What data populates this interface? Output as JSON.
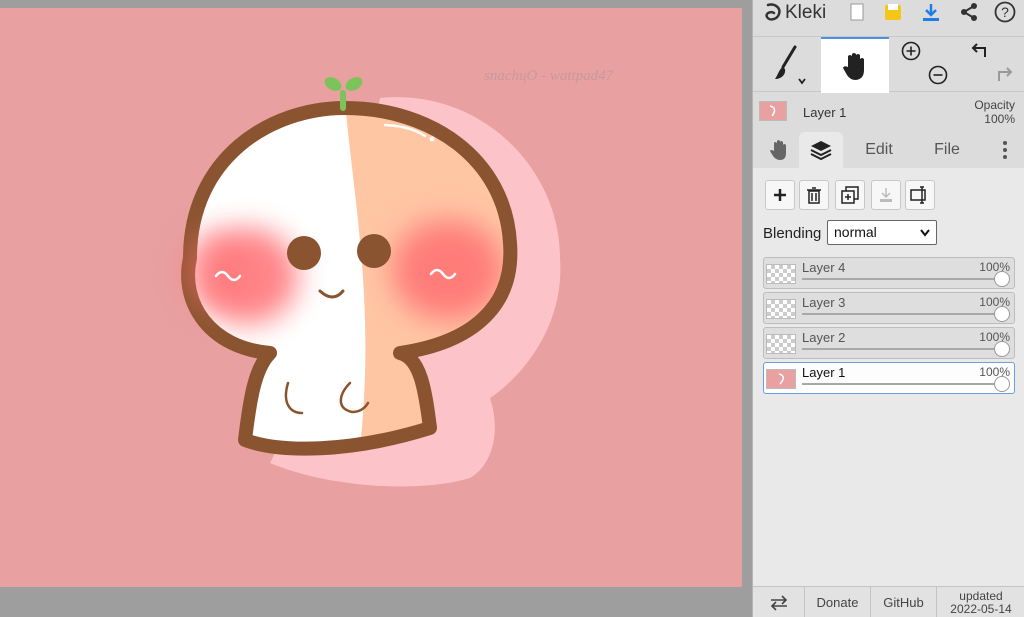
{
  "app": {
    "name": "Kleki"
  },
  "canvas": {
    "signature": "snaсhцO - wattpad47",
    "background": "#e8a0a0"
  },
  "topbar": {
    "icons": [
      "new-file-icon",
      "save-icon",
      "download-icon",
      "share-icon",
      "help-icon"
    ],
    "help_glyph": "?"
  },
  "tools": {
    "brush": "brush-icon",
    "hand": "hand-icon",
    "zoom_in": "zoom-in-icon",
    "zoom_out": "zoom-out-icon",
    "undo": "undo-icon",
    "redo": "redo-icon"
  },
  "current_layer": {
    "name": "Layer 1",
    "opacity_label": "Opacity",
    "opacity_value": "100%"
  },
  "tabs": {
    "edit": "Edit",
    "file": "File"
  },
  "blending": {
    "label": "Blending",
    "value": "normal"
  },
  "layers": [
    {
      "name": "Layer 4",
      "opacity": "100%",
      "active": false
    },
    {
      "name": "Layer 3",
      "opacity": "100%",
      "active": false
    },
    {
      "name": "Layer 2",
      "opacity": "100%",
      "active": false
    },
    {
      "name": "Layer 1",
      "opacity": "100%",
      "active": true
    }
  ],
  "footer": {
    "donate": "Donate",
    "github": "GitHub",
    "updated_line1": "updated",
    "updated_line2": "2022-05-14"
  },
  "colors": {
    "accent": "#4a90e2",
    "brown": "#8b5430",
    "peach": "#ffc6a4",
    "blush": "#ff6f73",
    "sprout": "#7cc35a"
  }
}
